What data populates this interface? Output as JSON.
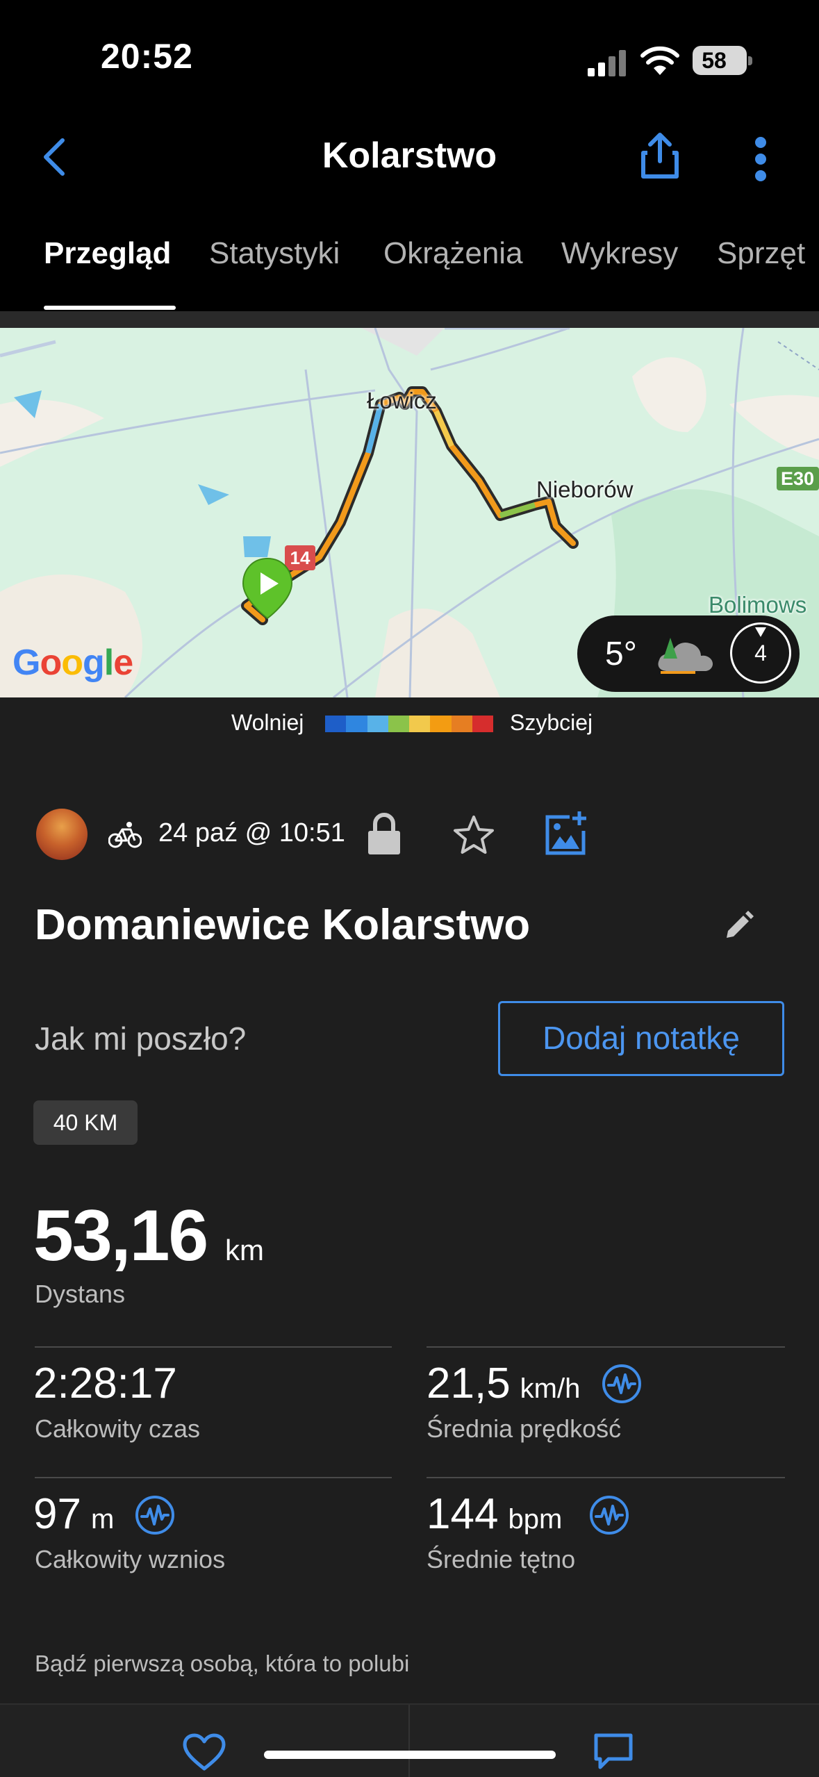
{
  "status_bar": {
    "time": "20:52",
    "battery": "58"
  },
  "header": {
    "title": "Kolarstwo"
  },
  "tabs": [
    {
      "label": "Przegląd",
      "active": true
    },
    {
      "label": "Statystyki"
    },
    {
      "label": "Okrążenia"
    },
    {
      "label": "Wykresy"
    },
    {
      "label": "Sprzęt"
    }
  ],
  "map": {
    "cities": [
      "Łowicz",
      "Nieborów",
      "Bolimows"
    ],
    "road_badge": "14",
    "highway_badge": "E30",
    "provider": "Google",
    "weather": {
      "temperature": "5°",
      "wind": "4"
    }
  },
  "legend": {
    "slower": "Wolniej",
    "faster": "Szybciej",
    "colors": [
      "#1e5ec8",
      "#2f86e0",
      "#58b2e8",
      "#8bc34a",
      "#f2c94c",
      "#f39c12",
      "#e67e22",
      "#d62d2d"
    ]
  },
  "activity": {
    "date": "24 paź @ 10:51",
    "name": "Domaniewice Kolarstwo",
    "how_prompt": "Jak mi poszło?",
    "add_note": "Dodaj notatkę",
    "tag": "40 KM"
  },
  "stats": {
    "distance": {
      "value": "53,16",
      "unit": "km",
      "label": "Dystans"
    },
    "total_time": {
      "value": "2:28:17",
      "label": "Całkowity czas"
    },
    "avg_speed": {
      "value": "21,5",
      "unit": "km/h",
      "label": "Średnia prędkość"
    },
    "elevation": {
      "value": "97",
      "unit": "m",
      "label": "Całkowity wznios"
    },
    "heart_rate": {
      "value": "144",
      "unit": "bpm",
      "label": "Średnie tętno"
    }
  },
  "likes_text": "Bądź pierwszą osobą, która to polubi",
  "colors": {
    "accent": "#3f8ce8",
    "background": "#1e1e1e"
  }
}
